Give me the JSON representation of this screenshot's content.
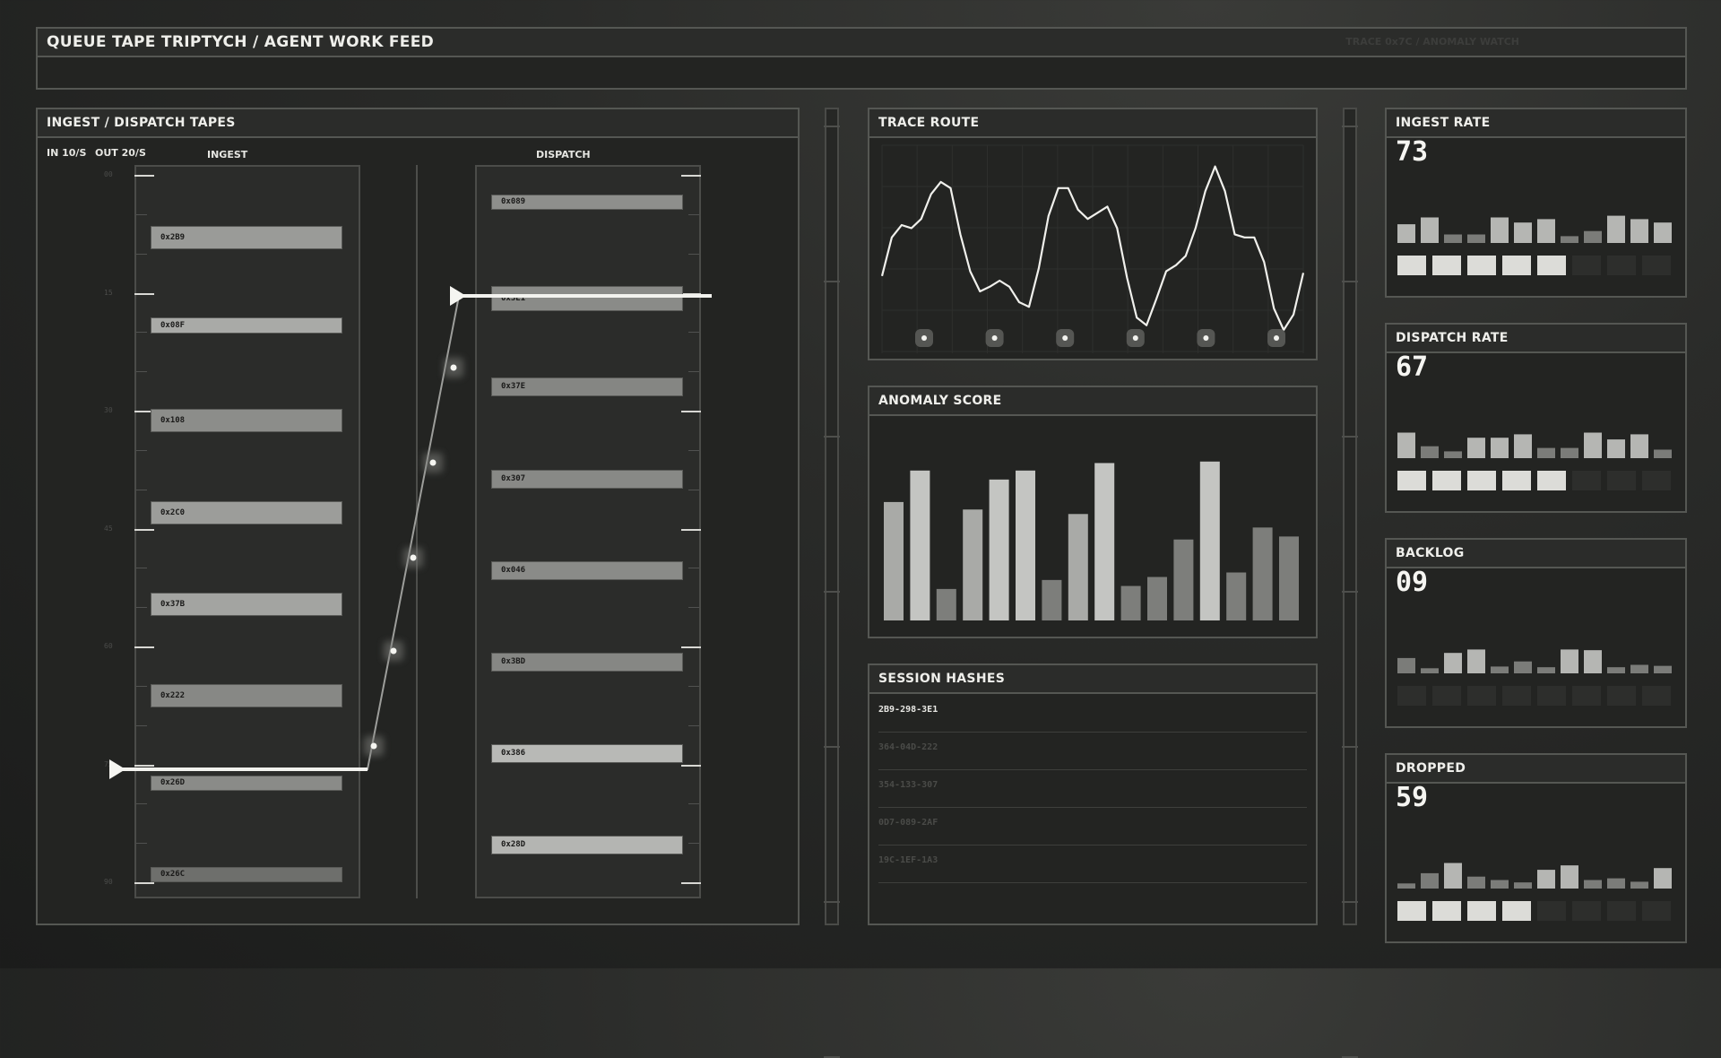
{
  "header": {
    "title": "QUEUE TAPE TRIPTYCH / AGENT WORK FEED",
    "trace_label": "TRACE 0x7C / ANOMALY WATCH"
  },
  "tapes": {
    "title": "INGEST / DISPATCH TAPES",
    "rate_in": "IN 10/S",
    "rate_out": "OUT 20/S",
    "ingest_label": "INGEST",
    "dispatch_label": "DISPATCH",
    "scale": [
      "00",
      "15",
      "30",
      "45",
      "60",
      "75",
      "90"
    ],
    "ingest_items": [
      {
        "id": "0x2B9",
        "shade": "#9a9b98"
      },
      {
        "id": "0x08F",
        "shade": "#a9aaa7"
      },
      {
        "id": "0x108",
        "shade": "#8c8d8a"
      },
      {
        "id": "0x2C0",
        "shade": "#9c9d9a"
      },
      {
        "id": "0x37B",
        "shade": "#a3a4a1"
      },
      {
        "id": "0x222",
        "shade": "#878885"
      },
      {
        "id": "0x26D",
        "shade": "#8a8b88"
      },
      {
        "id": "0x26C",
        "shade": "#6e6f6c"
      }
    ],
    "dispatch_items": [
      {
        "id": "0x089",
        "shade": "#8e8f8c"
      },
      {
        "id": "0x3E1",
        "shade": "#8a8b88"
      },
      {
        "id": "0x37E",
        "shade": "#858683"
      },
      {
        "id": "0x307",
        "shade": "#888986"
      },
      {
        "id": "0x046",
        "shade": "#8a8b88"
      },
      {
        "id": "0x3BD",
        "shade": "#868784"
      },
      {
        "id": "0x386",
        "shade": "#b8b9b6"
      },
      {
        "id": "0x28D",
        "shade": "#b4b5b2"
      }
    ]
  },
  "trace_route": {
    "title": "TRACE ROUTE",
    "values": [
      35,
      60,
      68,
      66,
      72,
      88,
      96,
      92,
      62,
      38,
      25,
      28,
      32,
      28,
      18,
      15,
      40,
      74,
      92,
      92,
      78,
      72,
      76,
      80,
      66,
      34,
      8,
      3,
      20,
      38,
      42,
      48,
      66,
      90,
      106,
      90,
      62,
      60,
      60,
      44,
      14,
      0,
      10,
      37
    ],
    "node_count": 6
  },
  "anomaly": {
    "title": "ANOMALY SCORE",
    "values": [
      0.79,
      1.0,
      0.21,
      0.74,
      0.94,
      1.0,
      0.27,
      0.71,
      1.05,
      0.23,
      0.29,
      0.54,
      1.06,
      0.32,
      0.62,
      0.56
    ]
  },
  "hashes": {
    "title": "SESSION HASHES",
    "rows": [
      "2B9-298-3E1",
      "364-04D-222",
      "354-133-307",
      "0D7-089-2AF",
      "19C-1EF-1A3"
    ]
  },
  "metrics": [
    {
      "title": "INGEST RATE",
      "value": "73",
      "bars": [
        0.55,
        0.75,
        0.25,
        0.25,
        0.75,
        0.6,
        0.7,
        0.2,
        0.35,
        0.8,
        0.7,
        0.6
      ],
      "lit": 5
    },
    {
      "title": "DISPATCH RATE",
      "value": "67",
      "bars": [
        0.75,
        0.35,
        0.2,
        0.6,
        0.6,
        0.7,
        0.3,
        0.3,
        0.75,
        0.55,
        0.7,
        0.25
      ],
      "lit": 5
    },
    {
      "title": "BACKLOG",
      "value": "09",
      "bars": [
        0.45,
        0.15,
        0.6,
        0.7,
        0.2,
        0.35,
        0.18,
        0.7,
        0.68,
        0.18,
        0.25,
        0.22
      ],
      "lit": 0
    },
    {
      "title": "DROPPED",
      "value": "59",
      "bars": [
        0.15,
        0.45,
        0.75,
        0.35,
        0.25,
        0.18,
        0.55,
        0.68,
        0.25,
        0.3,
        0.2,
        0.6
      ],
      "lit": 4
    }
  ]
}
